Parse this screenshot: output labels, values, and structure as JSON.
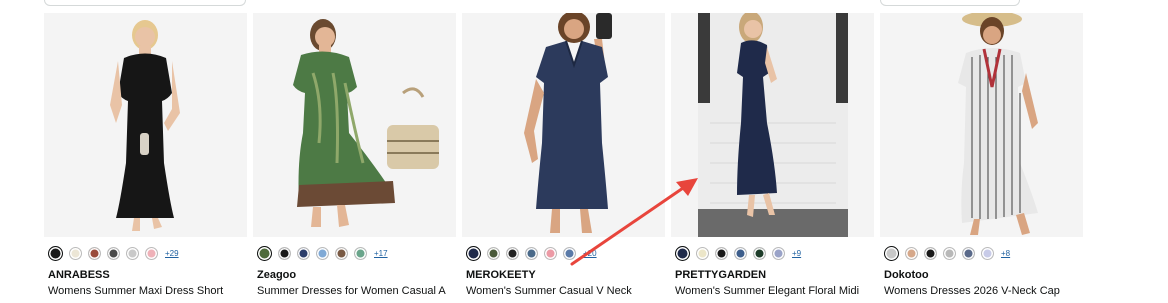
{
  "products": [
    {
      "brand": "ANRABESS",
      "title": "Womens Summer Maxi Dress Short",
      "more_colors": "+29",
      "swatches": [
        "#1a1a1a",
        "#ece6d6",
        "#9a4a3a",
        "#4a4a4a",
        "#c9c9c9",
        "#efb1b8"
      ],
      "image": "black-maxi-dress"
    },
    {
      "brand": "Zeagoo",
      "title": "Summer Dresses for Women Casual A",
      "more_colors": "+17",
      "swatches": [
        "#4e6b3b",
        "#1a1a1a",
        "#2b3d6b",
        "#7fa9d6",
        "#7a5a44",
        "#6aa58b"
      ],
      "image": "green-floral-dress"
    },
    {
      "brand": "MEROKEETY",
      "title": "Women's Summer Casual V Neck",
      "more_colors": "+20",
      "swatches": [
        "#1f2a4a",
        "#4a5a3a",
        "#222222",
        "#4a6a8a",
        "#ec9aa5",
        "#5a7aa8"
      ],
      "image": "navy-shift-dress"
    },
    {
      "brand": "PRETTYGARDEN",
      "title": "Women's Summer Elegant Floral Midi",
      "more_colors": "+9",
      "swatches": [
        "#1f2a4a",
        "#ece6c8",
        "#1a1a1a",
        "#3d5e8c",
        "#1e3d2a",
        "#9aa3c8"
      ],
      "image": "navy-midi-dress"
    },
    {
      "brand": "Dokotoo",
      "title": "Womens Dresses 2026 V-Neck Cap",
      "more_colors": "+8",
      "swatches": [
        "#c8c8c8",
        "#d6a88a",
        "#1a1a1a",
        "#b8b8b8",
        "#5a6a8a",
        "#c8cbe8"
      ],
      "image": "striped-white-dress"
    }
  ],
  "colors": {
    "link": "#2162a1",
    "annotation_arrow": "#e8453c"
  }
}
